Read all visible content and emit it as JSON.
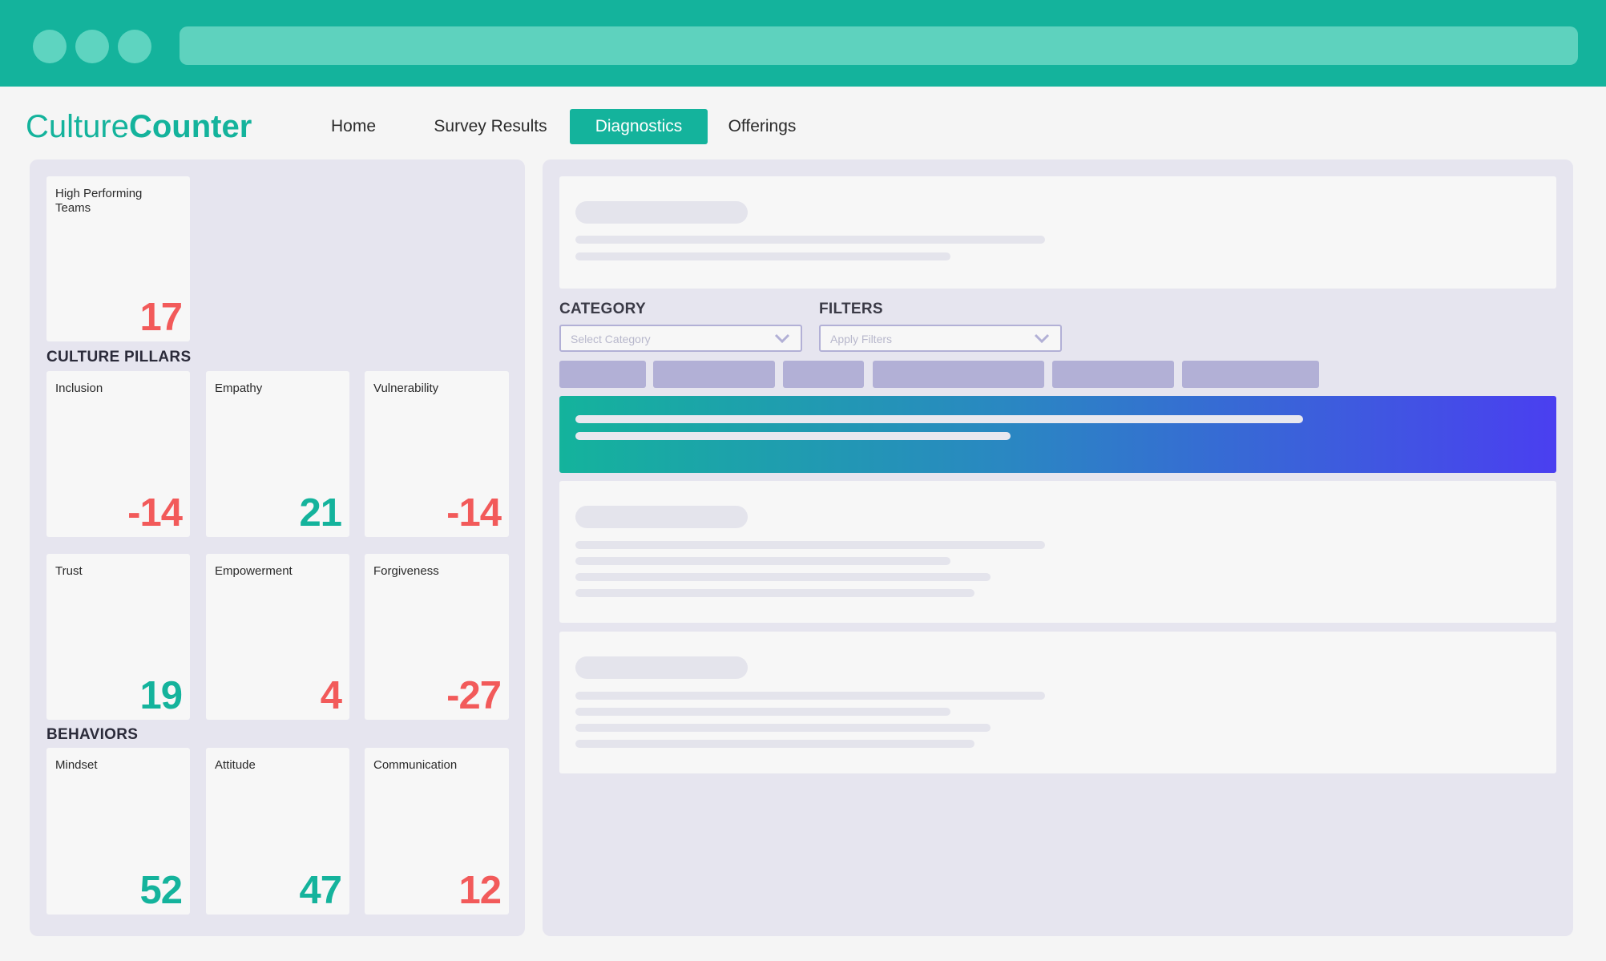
{
  "app": {
    "logo_part1": "Culture",
    "logo_part2": "Counter"
  },
  "nav": {
    "items": [
      {
        "label": "Home",
        "active": false
      },
      {
        "label": "Survey Results",
        "active": false
      },
      {
        "label": "Diagnostics",
        "active": true
      },
      {
        "label": "Offerings",
        "active": false
      }
    ]
  },
  "overview": {
    "high_performing": {
      "label_line1": "High Performing",
      "label_line2": "Teams",
      "value": "17"
    }
  },
  "culture_pillars": {
    "title": "CULTURE PILLARS",
    "items": [
      {
        "label": "Inclusion",
        "value": "-14"
      },
      {
        "label": "Empathy",
        "value": "21"
      },
      {
        "label": "Vulnerability",
        "value": "-14"
      },
      {
        "label": "Trust",
        "value": "19"
      },
      {
        "label": "Empowerment",
        "value": "4"
      },
      {
        "label": "Forgiveness",
        "value": "-27"
      }
    ]
  },
  "behaviors": {
    "title": "BEHAVIORS",
    "items": [
      {
        "label": "Mindset",
        "value": "52"
      },
      {
        "label": "Attitude",
        "value": "47"
      },
      {
        "label": "Communication",
        "value": "12"
      }
    ]
  },
  "filters": {
    "category_title": "CATEGORY",
    "category_placeholder": "Select Category",
    "filters_title": "FILTERS",
    "filters_placeholder": "Apply Filters"
  },
  "icons": {
    "dropdown": "chevron-down-icon"
  },
  "colors": {
    "brand": "#14b39c",
    "positive": "#14b39c",
    "negative": "#f25a5a",
    "chip": "#b2b0d6",
    "gradient_end": "#4a3ff0"
  }
}
